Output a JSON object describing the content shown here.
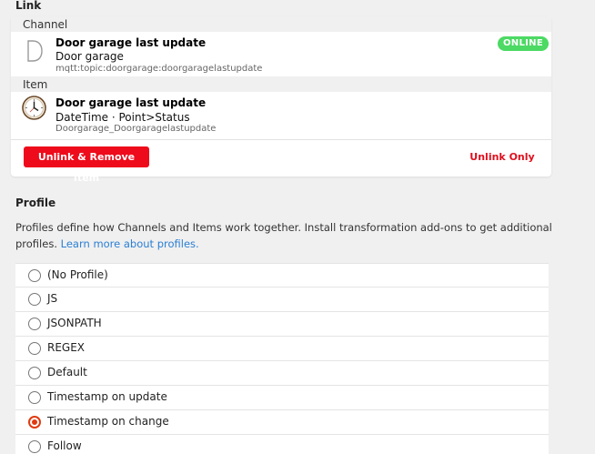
{
  "link_section": {
    "title": "Link"
  },
  "channel": {
    "group_label": "Channel",
    "title": "Door garage last update",
    "subtitle": "Door garage",
    "meta": "mqtt:topic:doorgarage:doorgaragelastupdate",
    "status_badge": "ONLINE",
    "status_color": "#4cd964",
    "icon": "channel-letter-d-icon"
  },
  "item": {
    "group_label": "Item",
    "title": "Door garage last update",
    "subtitle": "DateTime · Point>Status",
    "meta": "Doorgarage_Doorgaragelastupdate",
    "icon": "clock-icon"
  },
  "actions": {
    "unlink_remove_label": "Unlink & Remove Item",
    "unlink_only_label": "Unlink Only",
    "danger_color": "#ee0b1b"
  },
  "profile": {
    "title": "Profile",
    "description": "Profiles define how Channels and Items work together. Install transformation add-ons to get additional profiles.",
    "learn_more_link": "Learn more about profiles.",
    "options": [
      {
        "label": "(No Profile)",
        "checked": false
      },
      {
        "label": "JS",
        "checked": false
      },
      {
        "label": "JSONPATH",
        "checked": false
      },
      {
        "label": "REGEX",
        "checked": false
      },
      {
        "label": "Default",
        "checked": false
      },
      {
        "label": "Timestamp on update",
        "checked": false
      },
      {
        "label": "Timestamp on change",
        "checked": true
      },
      {
        "label": "Follow",
        "checked": false
      }
    ],
    "accent_color": "#e03a10"
  }
}
